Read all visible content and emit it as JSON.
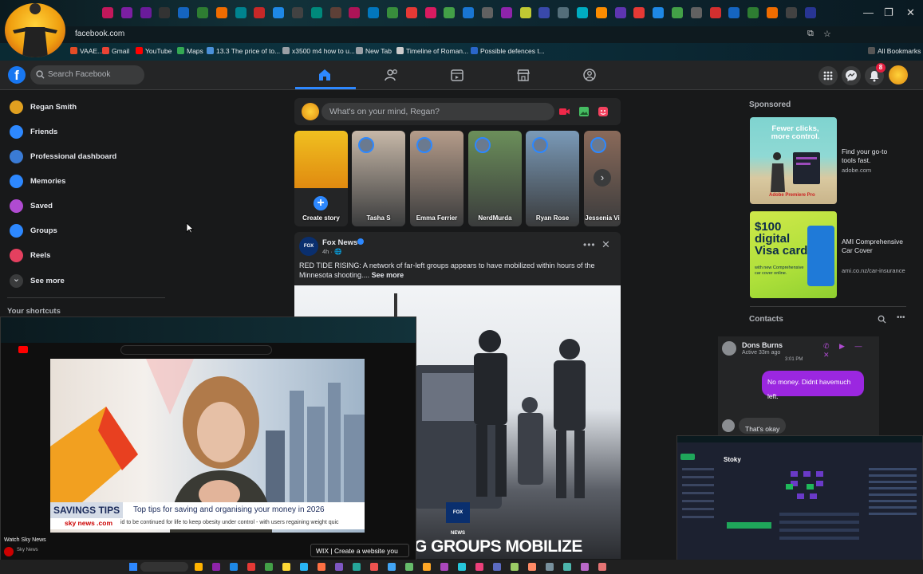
{
  "browser": {
    "url": "facebook.com",
    "bookmarks": [
      {
        "label": "VAAE...",
        "color": "#e34c26"
      },
      {
        "label": "Gmail",
        "color": "#ea4335"
      },
      {
        "label": "YouTube",
        "color": "#ff0000"
      },
      {
        "label": "Maps",
        "color": "#34a853"
      },
      {
        "label": "13.3 The price of to...",
        "color": "#4a90d9"
      },
      {
        "label": "x3500 m4 how to u...",
        "color": "#9aa0a6"
      },
      {
        "label": "New Tab",
        "color": "#9aa0a6"
      },
      {
        "label": "Timeline of Roman...",
        "color": "#cccccc"
      },
      {
        "label": "Possible defences t...",
        "color": "#2a66c9"
      }
    ],
    "all_bookmarks": "All Bookmarks",
    "window_controls": [
      "—",
      "❐",
      "✕"
    ]
  },
  "fb_header": {
    "logo": "f",
    "search_placeholder": "Search Facebook",
    "notification_count": "8"
  },
  "sidebar": {
    "items": [
      {
        "label": "Regan Smith",
        "icon": "profile-avatar",
        "color": "#e0a020"
      },
      {
        "label": "Friends",
        "icon": "friends-icon",
        "color": "#2d88ff"
      },
      {
        "label": "Professional dashboard",
        "icon": "dashboard-icon",
        "color": "#3a7bd5"
      },
      {
        "label": "Memories",
        "icon": "clock-icon",
        "color": "#2d88ff"
      },
      {
        "label": "Saved",
        "icon": "bookmark-icon",
        "color": "#b04bd1"
      },
      {
        "label": "Groups",
        "icon": "groups-icon",
        "color": "#2d88ff"
      },
      {
        "label": "Reels",
        "icon": "reels-icon",
        "color": "#e4405f"
      },
      {
        "label": "See more",
        "icon": "chevron-down-icon",
        "color": "#3a3b3c"
      }
    ],
    "shortcuts_heading": "Your shortcuts"
  },
  "composer": {
    "placeholder": "What's on your mind, Regan?"
  },
  "stories": [
    {
      "name": "Create story",
      "bg": "#f0c020"
    },
    {
      "name": "Tasha S",
      "bg": "#c7b8a8"
    },
    {
      "name": "Emma Ferrier",
      "bg": "#b59c8a"
    },
    {
      "name": "NerdMurda",
      "bg": "#6b8f5a"
    },
    {
      "name": "Ryan Rose",
      "bg": "#7a9ab8"
    },
    {
      "name": "Jessenia Vi",
      "bg": "#8a6a5a"
    }
  ],
  "post": {
    "author": "Fox News",
    "meta": "4h · 🌐",
    "text": "RED TIDE RISING: A network of far-left groups appears to have mobilized within hours of the Minnesota shooting....",
    "see_more": "See more",
    "image_caption": "G GROUPS MOBILIZE",
    "watermark": "FOX NEWS"
  },
  "sponsored": {
    "heading": "Sponsored",
    "ads": [
      {
        "title": "Find your go-to tools fast.",
        "url": "adobe.com",
        "image_text": "Fewer clicks, more control.",
        "image_sub": "Adobe Premiere Pro"
      },
      {
        "title": "AMI Comprehensive Car Cover",
        "url": "ami.co.nz/car-insurance",
        "image_text": "$100 digital Visa card",
        "image_sub": "with new Comprehensive car cover online."
      }
    ]
  },
  "contacts": {
    "heading": "Contacts"
  },
  "messenger": {
    "name": "Dons Burns",
    "status": "Active 33m ago",
    "time": "3:01 PM",
    "sent": "No money. Didnt havemuch left.",
    "received": "That's okay"
  },
  "youtube_pip": {
    "banner": "SAVINGS TIPS",
    "headline": "Top tips for saving and organising your money in 2026",
    "source": "sky news .com",
    "ticker": "id to be continued for life to keep obesity under control - with users regaining weight quic",
    "channel": "Watch Sky News",
    "subchannel": "Sky News",
    "ad": "WIX | Create a website you"
  },
  "stocky": {
    "title": "Stoky"
  }
}
